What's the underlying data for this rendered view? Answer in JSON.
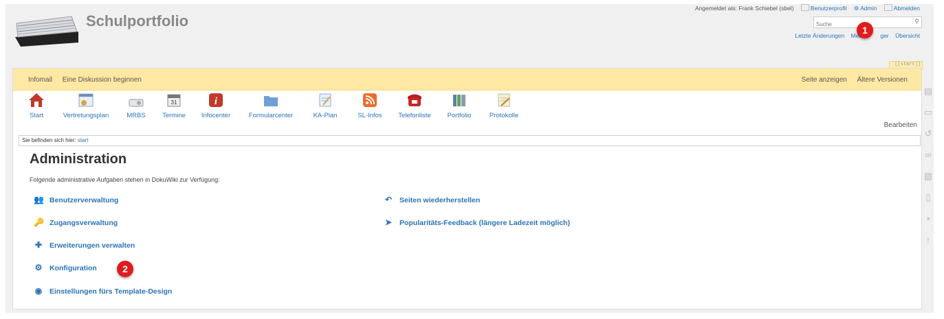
{
  "header": {
    "site_title": "Schulportfolio",
    "logged_in_as": "Angemeldet als: Frank Schiebel (sbel)",
    "user_links": [
      "Benutzerprofil",
      "Admin",
      "Abmelden"
    ],
    "search_placeholder": "Suche",
    "site_tools": [
      "Letzte Änderungen",
      "Medi",
      "ger",
      "Übersicht"
    ],
    "page_id": "[[start]]"
  },
  "pagetools": {
    "left": [
      "Infomail",
      "Eine Diskussion beginnen"
    ],
    "right": [
      "Seite anzeigen",
      "Ältere Versionen"
    ]
  },
  "iconbar": [
    {
      "label": "Start",
      "icon": "home-icon",
      "color": "#c0392b"
    },
    {
      "label": "Vertretungsplan",
      "icon": "calendar-icon",
      "color": "#8aa7c9"
    },
    {
      "label": "MRBS",
      "icon": "device-icon",
      "color": "#b9c0c8"
    },
    {
      "label": "Termine",
      "icon": "date-icon",
      "color": "#9aa0a6"
    },
    {
      "label": "Infocenter",
      "icon": "info-icon",
      "color": "#c0392b"
    },
    {
      "label": "Formularcenter",
      "icon": "folder-icon",
      "color": "#6e9fd6"
    },
    {
      "label": "KA-Plan",
      "icon": "notepad-icon",
      "color": "#88aee0"
    },
    {
      "label": "SL-Infos",
      "icon": "rss-icon",
      "color": "#ef6b2a"
    },
    {
      "label": "Telefonliste",
      "icon": "phone-icon",
      "color": "#c62828"
    },
    {
      "label": "Portfolio",
      "icon": "binders-icon",
      "color": "#5fa35a"
    },
    {
      "label": "Protokolle",
      "icon": "edit-icon",
      "color": "#c9b88a"
    }
  ],
  "edit_label": "Bearbeiten",
  "breadcrumb": {
    "prefix": "Sie befinden sich hier:",
    "link": "start"
  },
  "content": {
    "title": "Administration",
    "intro": "Folgende administrative Aufgaben stehen in DokuWiki zur Verfügung:",
    "left_items": [
      {
        "label": "Benutzerverwaltung",
        "icon": "users-icon"
      },
      {
        "label": "Zugangsverwaltung",
        "icon": "key-icon"
      },
      {
        "label": "Erweiterungen verwalten",
        "icon": "puzzle-icon"
      },
      {
        "label": "Konfiguration",
        "icon": "gear-icon"
      },
      {
        "label": "Einstellungen fürs Template-Design",
        "icon": "palette-icon"
      }
    ],
    "right_items": [
      {
        "label": "Seiten wiederherstellen",
        "icon": "revert-icon"
      },
      {
        "label": "Popularitäts-Feedback (längere Ladezeit möglich)",
        "icon": "send-icon"
      }
    ]
  },
  "badges": [
    "1",
    "2"
  ],
  "colors": {
    "accent": "#2b73b7",
    "pagetools_bg": "#ffe8a3",
    "badge": "#e01b1b"
  }
}
